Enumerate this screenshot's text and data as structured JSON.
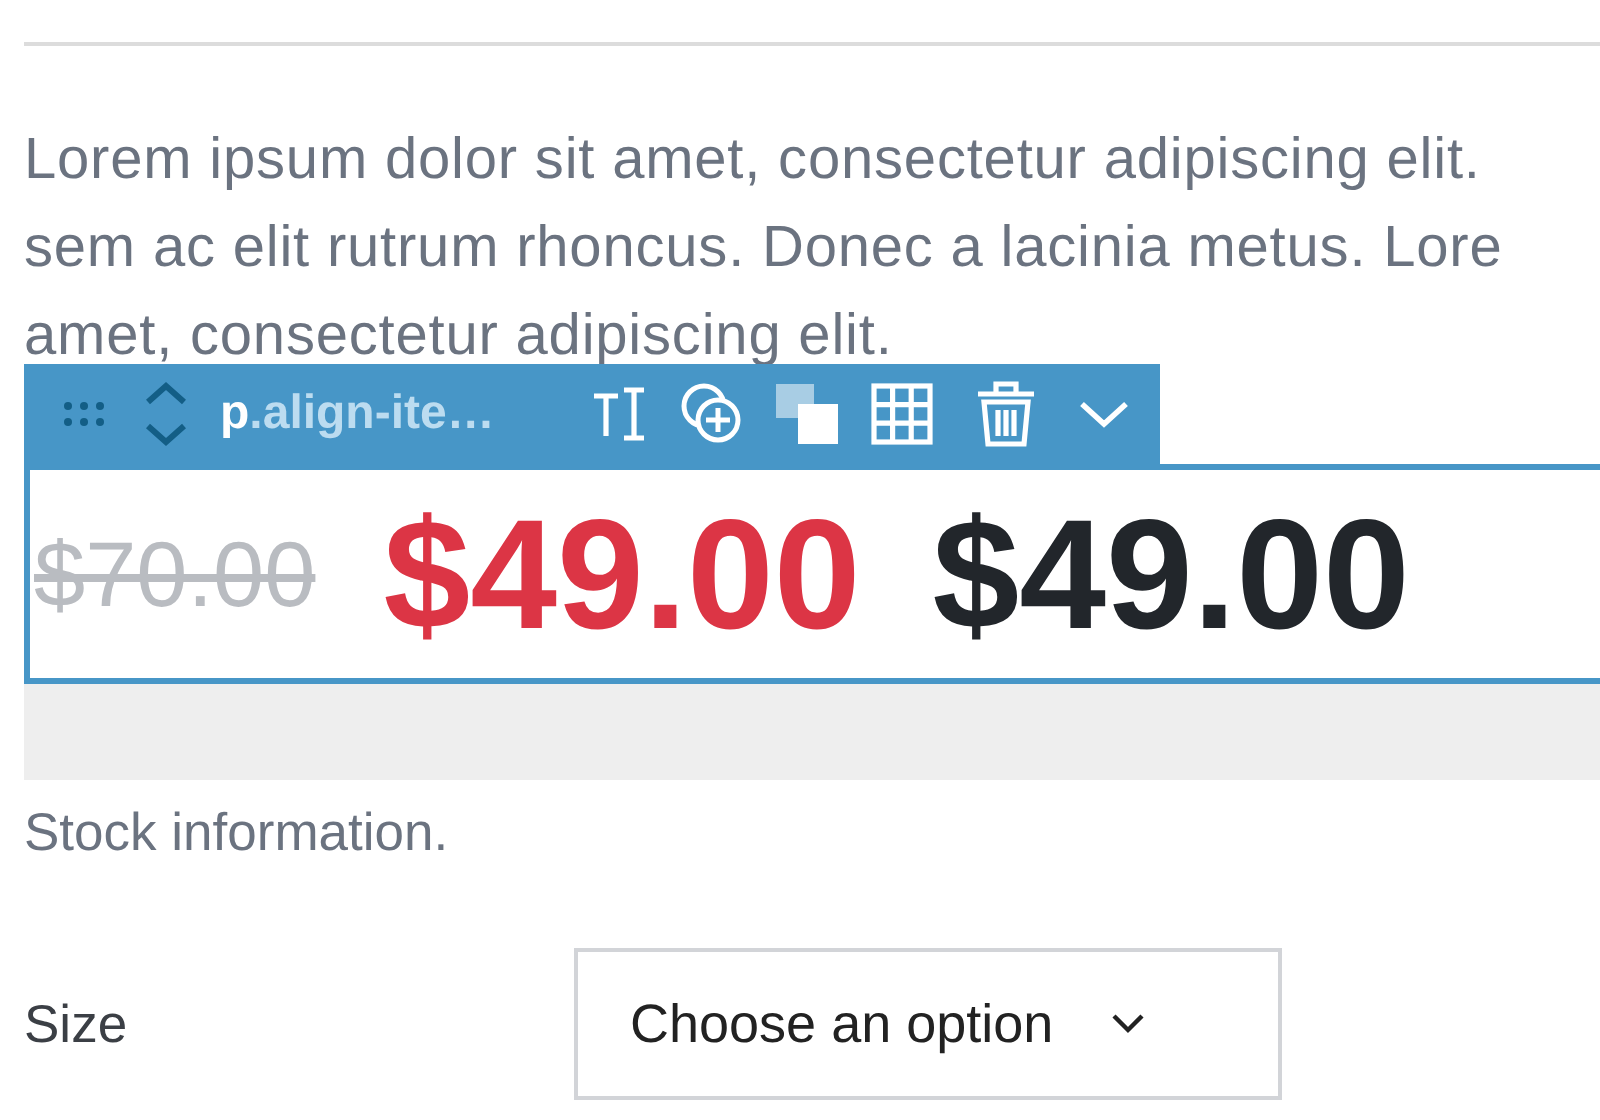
{
  "description": {
    "lines": [
      "Lorem ipsum dolor sit amet, consectetur adipiscing elit.",
      "sem ac elit rutrum rhoncus. Donec a lacinia metus. Lore",
      "amet, consectetur adipiscing elit."
    ]
  },
  "block_toolbar": {
    "tag": "p",
    "classes": ".align-ite…"
  },
  "price": {
    "old": "$70.00",
    "sale": "$49.00",
    "regular": "$49.00"
  },
  "stock_note": "Stock information.",
  "size": {
    "label": "Size",
    "select": "Choose an option"
  }
}
